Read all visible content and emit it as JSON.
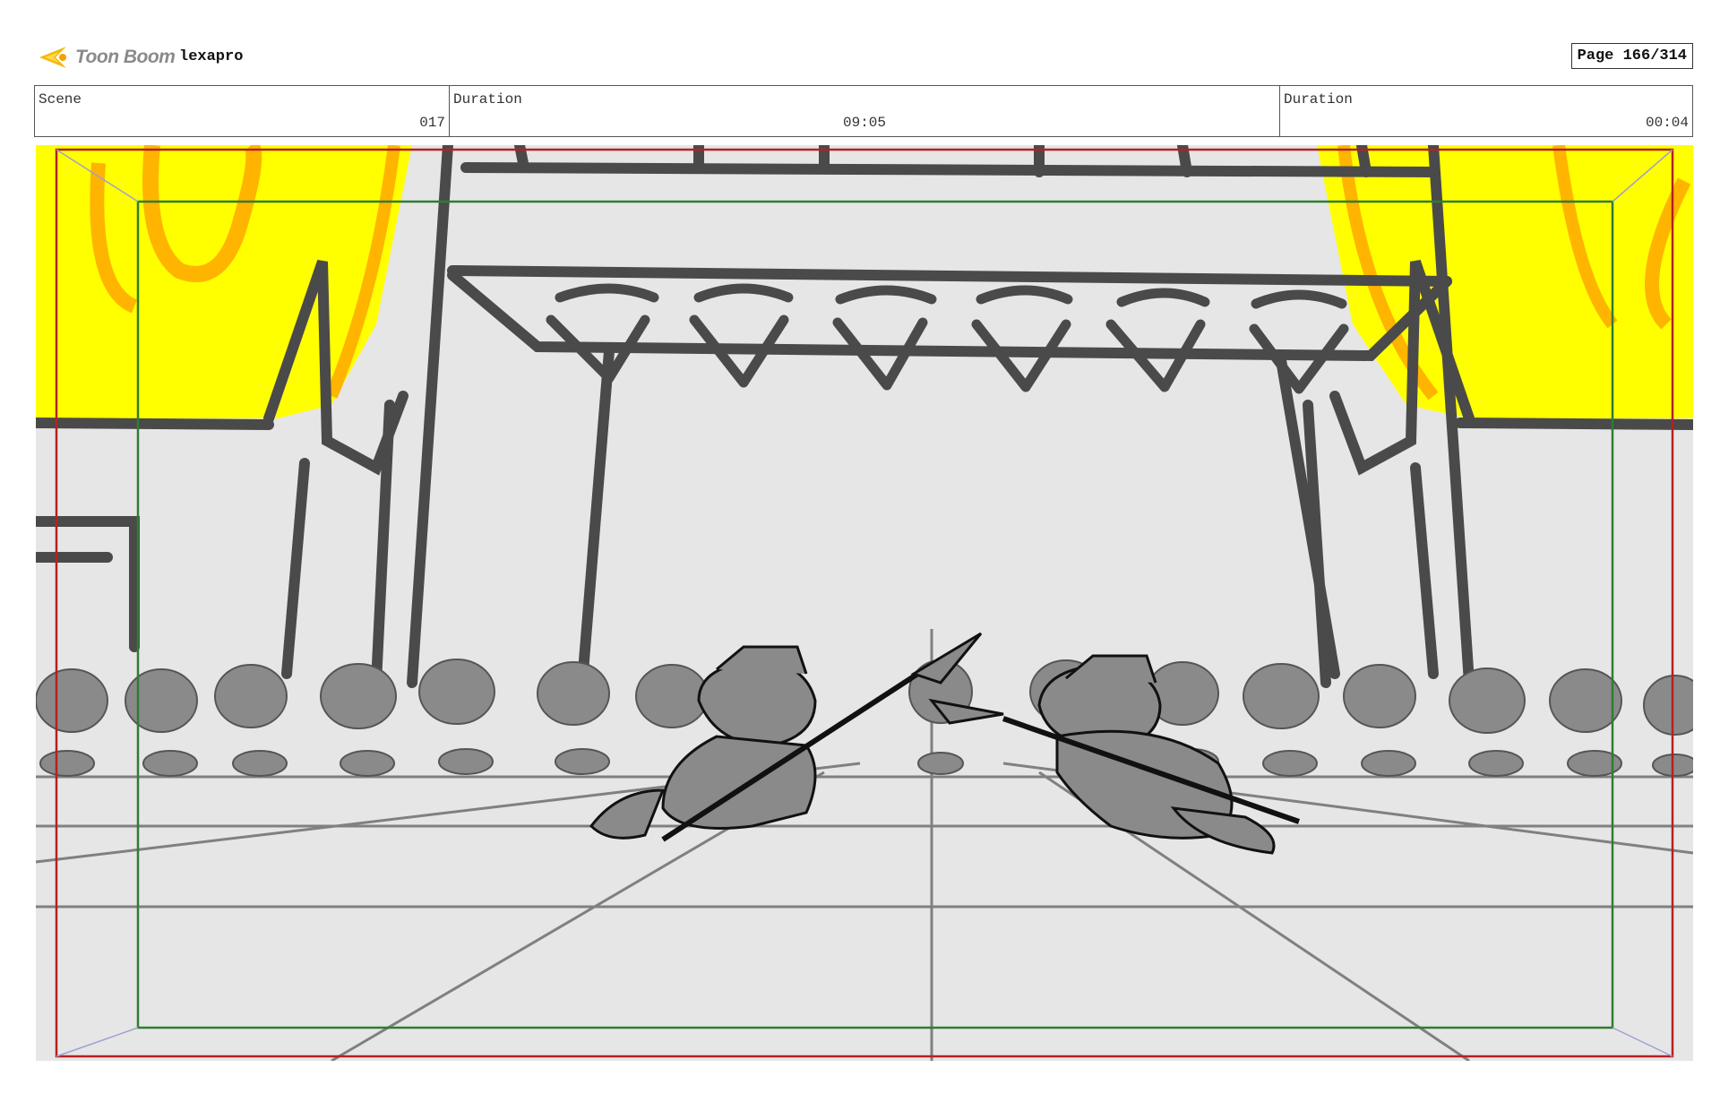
{
  "header": {
    "logo_text": "Toon Boom",
    "project_name": "lexapro",
    "page_label": "Page 166/314"
  },
  "info": {
    "scene_label": "Scene",
    "scene_value": "017",
    "duration1_label": "Duration",
    "duration1_value": "09:05",
    "duration2_label": "Duration",
    "duration2_value": "00:04"
  },
  "colors": {
    "curtain_yellow": "#ffff00",
    "curtain_orange": "#ffb400",
    "background_gray": "#e6e6e6",
    "structure_dark": "#4a4a4a",
    "crowd_gray": "#8a8a8a",
    "safe_frame_red": "#b22222",
    "title_safe_green": "#2e7d32"
  },
  "icons": {
    "logo": "toon-boom-logo-icon"
  }
}
